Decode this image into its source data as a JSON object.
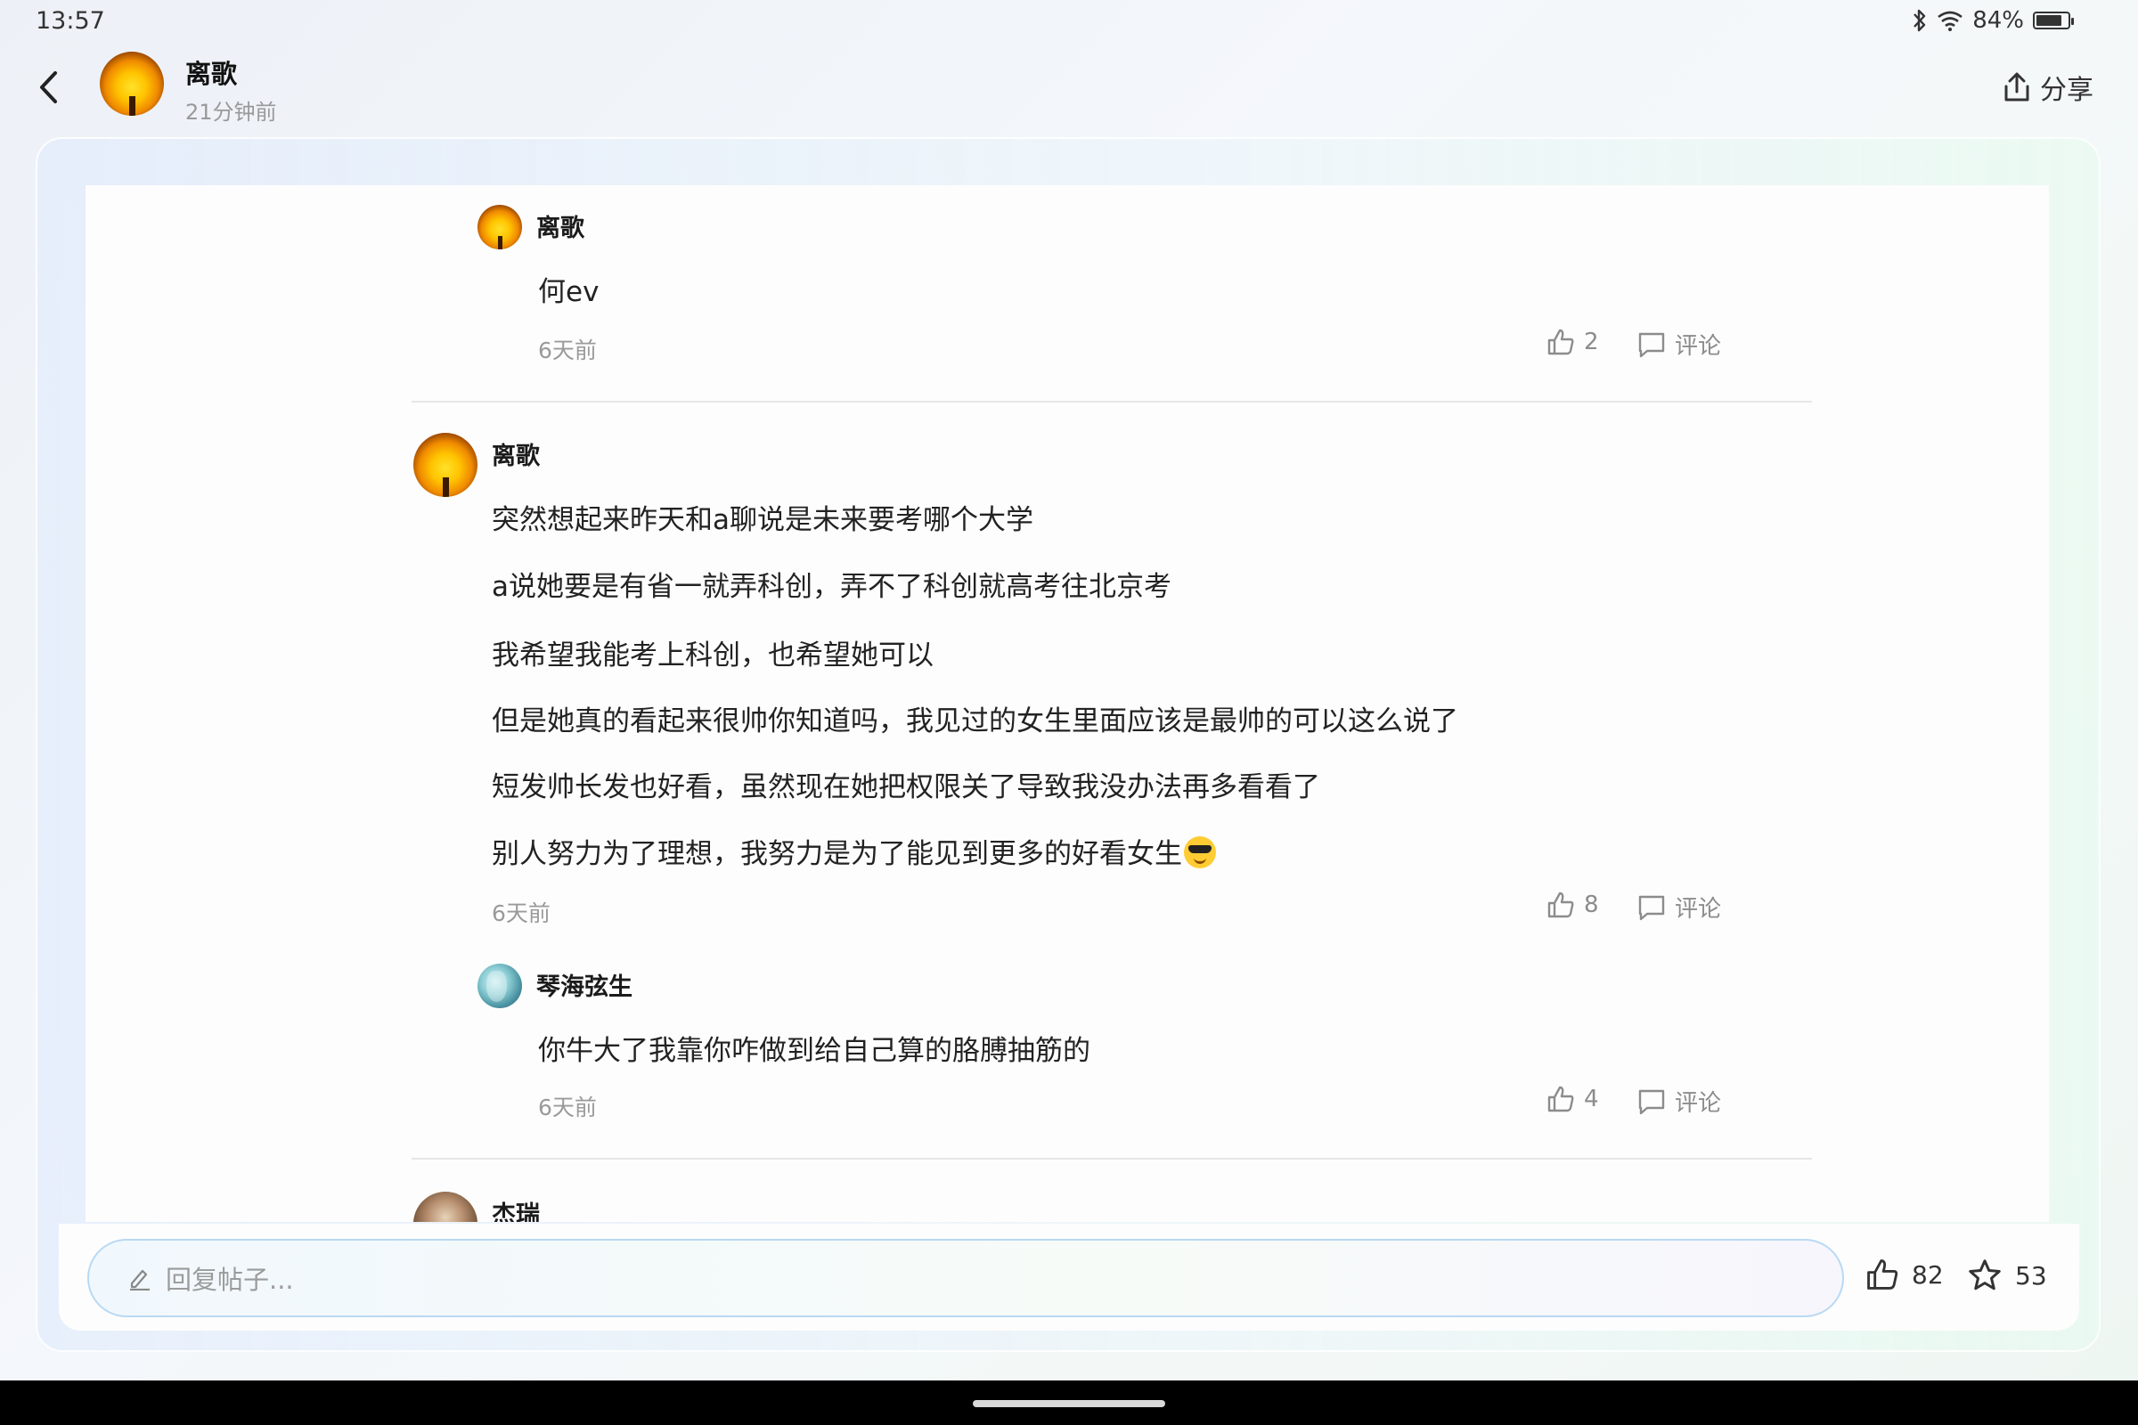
{
  "status_bar": {
    "time": "13:57",
    "battery": "84%",
    "battery_fraction": 0.84
  },
  "header": {
    "author": "离歌",
    "time_ago": "21分钟前",
    "share_label": "分享"
  },
  "comments": [
    {
      "author": "离歌",
      "lines": [
        "何ev"
      ],
      "time": "6天前",
      "likes": "2",
      "comment_label": "评论"
    },
    {
      "author": "离歌",
      "lines": [
        "突然想起来昨天和a聊说是未来要考哪个大学",
        "a说她要是有省一就弄科创，弄不了科创就高考往北京考",
        "我希望我能考上科创，也希望她可以",
        "但是她真的看起来很帅你知道吗，我见过的女生里面应该是最帅的可以这么说了",
        "短发帅长发也好看，虽然现在她把权限关了导致我没办法再多看看了",
        "别人努力为了理想，我努力是为了能见到更多的好看女生"
      ],
      "time": "6天前",
      "likes": "8",
      "comment_label": "评论"
    },
    {
      "author": "琴海弦生",
      "lines": [
        "你牛大了我靠你咋做到给自己算的胳膊抽筋的"
      ],
      "time": "6天前",
      "likes": "4",
      "comment_label": "评论"
    },
    {
      "author": "杰瑞"
    }
  ],
  "reply_bar": {
    "placeholder": "回复帖子...",
    "likes": "82",
    "stars": "53"
  },
  "icons": {
    "back": "back-arrow-icon",
    "share": "share-icon",
    "like": "thumb-up-icon",
    "comment": "comment-bubble-icon",
    "star": "star-icon",
    "pencil": "pencil-icon"
  }
}
